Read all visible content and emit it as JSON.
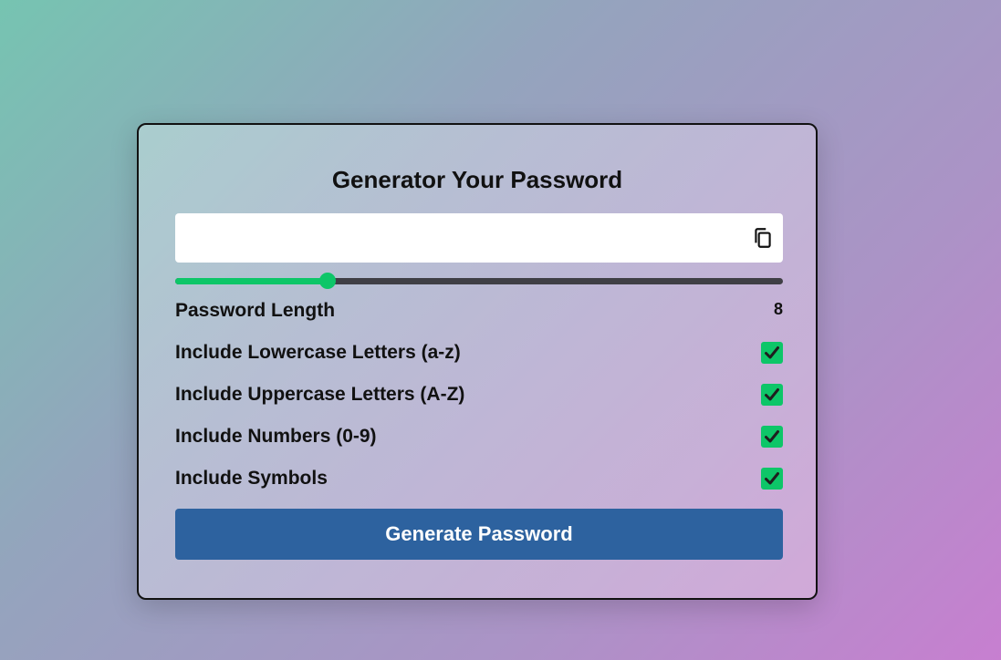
{
  "card": {
    "title": "Generator Your Password"
  },
  "output": {
    "value": "",
    "placeholder": "",
    "copy_icon": "copy-icon"
  },
  "length": {
    "label": "Password Length",
    "value": "8",
    "slider_fraction": 0.25
  },
  "options": [
    {
      "label": "Include Lowercase Letters (a-z)",
      "checked": true
    },
    {
      "label": "Include Uppercase Letters (A-Z)",
      "checked": true
    },
    {
      "label": "Include Numbers (0-9)",
      "checked": true
    },
    {
      "label": "Include Symbols",
      "checked": true
    }
  ],
  "generate_button": {
    "label": "Generate Password"
  },
  "colors": {
    "accent_green": "#0dc668",
    "button_blue": "#2d629f",
    "track_dark": "#3f3f45"
  }
}
